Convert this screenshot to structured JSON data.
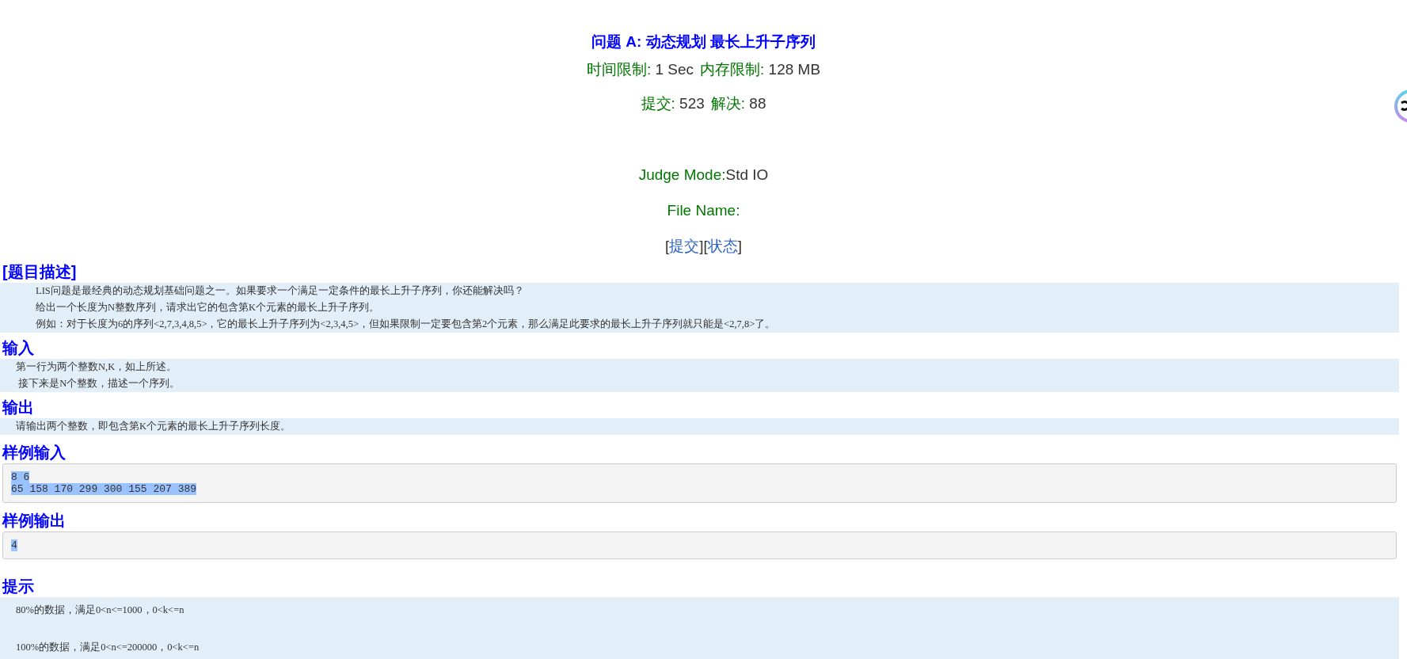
{
  "title": "问题 A: 动态规划 最长上升子序列",
  "limits": [
    {
      "label": "时间限制:",
      "value": "1 Sec"
    },
    {
      "label": "内存限制:",
      "value": "128 MB"
    }
  ],
  "stats": [
    {
      "label": "提交:",
      "value": "523"
    },
    {
      "label": "解决:",
      "value": "88"
    }
  ],
  "judge_mode": {
    "label": "Judge Mode:",
    "value": "Std IO"
  },
  "file_name": {
    "label": "File Name:"
  },
  "links": [
    {
      "open": "[",
      "label": "提交",
      "close": "]"
    },
    {
      "open": "[",
      "label": "状态",
      "close": "]"
    }
  ],
  "sections": [
    {
      "kind": "description",
      "heading": "[题目描述]",
      "lines": [
        "LIS问题是最经典的动态规划基础问题之一。如果要求一个满足一定条件的最长上升子序列，你还能解决吗？",
        "给出一个长度为N整数序列，请求出它的包含第K个元素的最长上升子序列。",
        "例如：对于长度为6的序列<2,7,3,4,8,5>，它的最长上升子序列为<2,3,4,5>，但如果限制一定要包含第2个元素，那么满足此要求的最长上升子序列就只能是<2,7,8>了。"
      ]
    },
    {
      "kind": "text",
      "heading": "输入",
      "lines": [
        "第一行为两个整数N,K，如上所述。",
        " 接下来是N个整数，描述一个序列。"
      ]
    },
    {
      "kind": "text",
      "heading": "输出",
      "lines": [
        "请输出两个整数，即包含第K个元素的最长上升子序列长度。"
      ]
    },
    {
      "kind": "code",
      "heading": "样例输入",
      "highlighted": true,
      "lines": [
        "8 6",
        "65 158 170 299 300 155 207 389"
      ]
    },
    {
      "kind": "code",
      "heading": "样例输出",
      "highlighted": true,
      "lines": [
        "4"
      ]
    },
    {
      "kind": "hint",
      "heading": "提示",
      "lines": [
        "80%的数据，满足0<n<=1000，0<k<=n",
        "100%的数据，满足0<n<=200000，0<k<=n"
      ]
    }
  ]
}
